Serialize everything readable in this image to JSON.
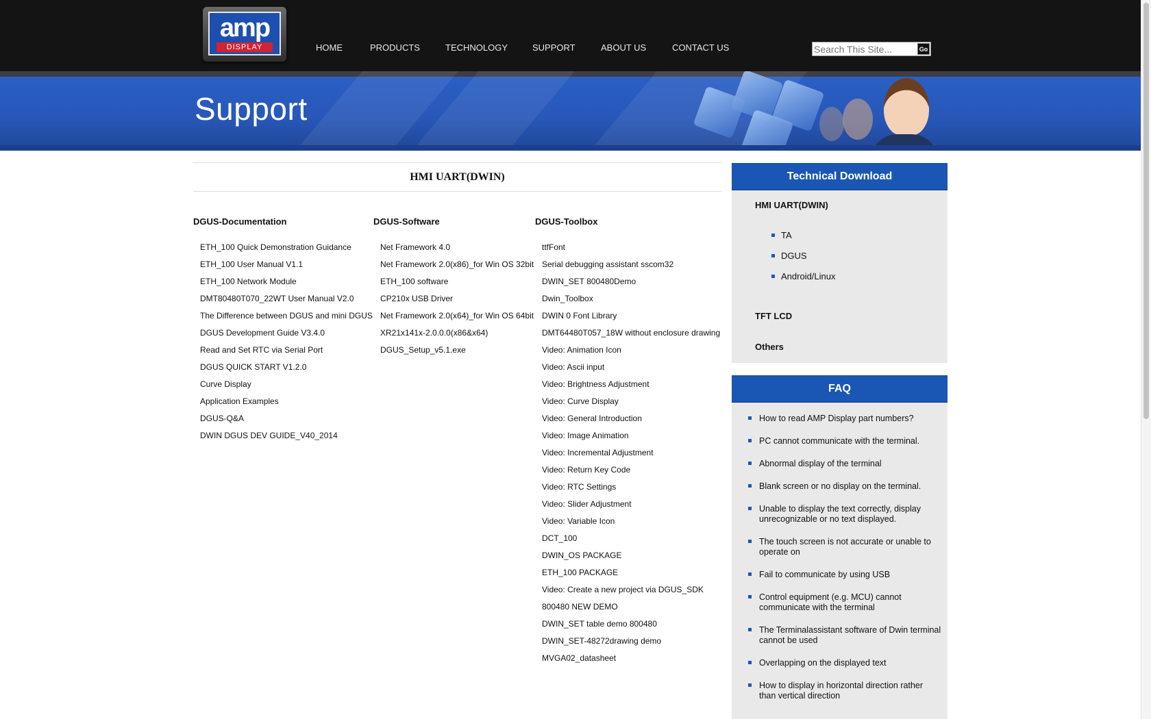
{
  "logo": {
    "amp": "amp",
    "display": "DISPLAY"
  },
  "nav": {
    "items": [
      {
        "label": "HOME"
      },
      {
        "label": "PRODUCTS"
      },
      {
        "label": "TECHNOLOGY"
      },
      {
        "label": "SUPPORT"
      },
      {
        "label": "ABOUT US"
      },
      {
        "label": "CONTACT US"
      }
    ]
  },
  "search": {
    "placeholder": "Search This Site...",
    "button_label": "Go"
  },
  "banner": {
    "title": "Support"
  },
  "main": {
    "heading": "HMI UART(DWIN)",
    "columns": [
      {
        "title": "DGUS-Documentation",
        "items": [
          "ETH_100 Quick Demonstration Guidance",
          "ETH_100 User Manual V1.1",
          "ETH_100 Network Module",
          "DMT80480T070_22WT User Manual V2.0",
          "The Difference between DGUS and mini DGUS",
          "DGUS Development Guide V3.4.0",
          "Read and Set RTC via Serial Port",
          "DGUS QUICK START V1.2.0",
          "Curve Display",
          "Application Examples",
          "DGUS-Q&A",
          "DWIN DGUS DEV GUIDE_V40_2014"
        ]
      },
      {
        "title": "DGUS-Software",
        "items": [
          "Net Framework 4.0",
          "Net Framework 2.0(x86)_for Win OS 32bit",
          "ETH_100 software",
          "CP210x USB Driver",
          "Net Framework 2.0(x64)_for Win OS 64bit",
          "XR21x141x-2.0.0.0(x86&x64)",
          "DGUS_Setup_v5.1.exe"
        ]
      },
      {
        "title": "DGUS-Toolbox",
        "items": [
          "ttfFont",
          "Serial debugging assistant sscom32",
          "DWIN_SET 800480Demo",
          "Dwin_Toolbox",
          "DWIN 0 Font Library",
          "DMT64480T057_18W without enclosure drawing",
          "Video: Animation Icon",
          "Video: Ascii input",
          "Video: Brightness Adjustment",
          "Video: Curve Display",
          "Video: General Introduction",
          "Video: Image Animation",
          "Video: Incremental Adjustment",
          "Video: Return Key Code",
          "Video: RTC Settings",
          "Video: Slider Adjustment",
          "Video: Variable Icon",
          "DCT_100",
          "DWIN_OS PACKAGE",
          "ETH_100 PACKAGE",
          "Video: Create a new project via DGUS_SDK",
          "800480 NEW DEMO",
          "DWIN_SET table demo 800480",
          "DWIN_SET-48272drawing demo",
          "MVGA02_datasheet"
        ]
      }
    ]
  },
  "sidebar": {
    "technical_download": {
      "title": "Technical Download",
      "category": "HMI UART(DWIN)",
      "subitems": [
        "TA",
        "DGUS",
        "Android/Linux"
      ],
      "other_categories": [
        "TFT LCD",
        "Others"
      ]
    },
    "faq": {
      "title": "FAQ",
      "items": [
        "How to read AMP Display part numbers?",
        "PC cannot communicate with the terminal.",
        "Abnormal display of the terminal",
        "Blank screen or no display on the terminal.",
        "Unable to display the text correctly, display unrecognizable or no text displayed.",
        "The touch screen is not accurate or unable to operate on",
        "Fail to communicate by using USB",
        "Control equipment (e.g. MCU) cannot communicate with the terminal",
        "The Terminalassistant software of Dwin terminal cannot be used",
        "Overlapping on the displayed text",
        "How to display in horizontal direction rather than vertical direction"
      ]
    }
  },
  "colors": {
    "header_bg": "#141414",
    "banner_blue": "#2a60c6",
    "panel_header_blue": "#1a56b4",
    "panel_bg": "#e9e9e9",
    "bullet": "#1f55b8"
  }
}
